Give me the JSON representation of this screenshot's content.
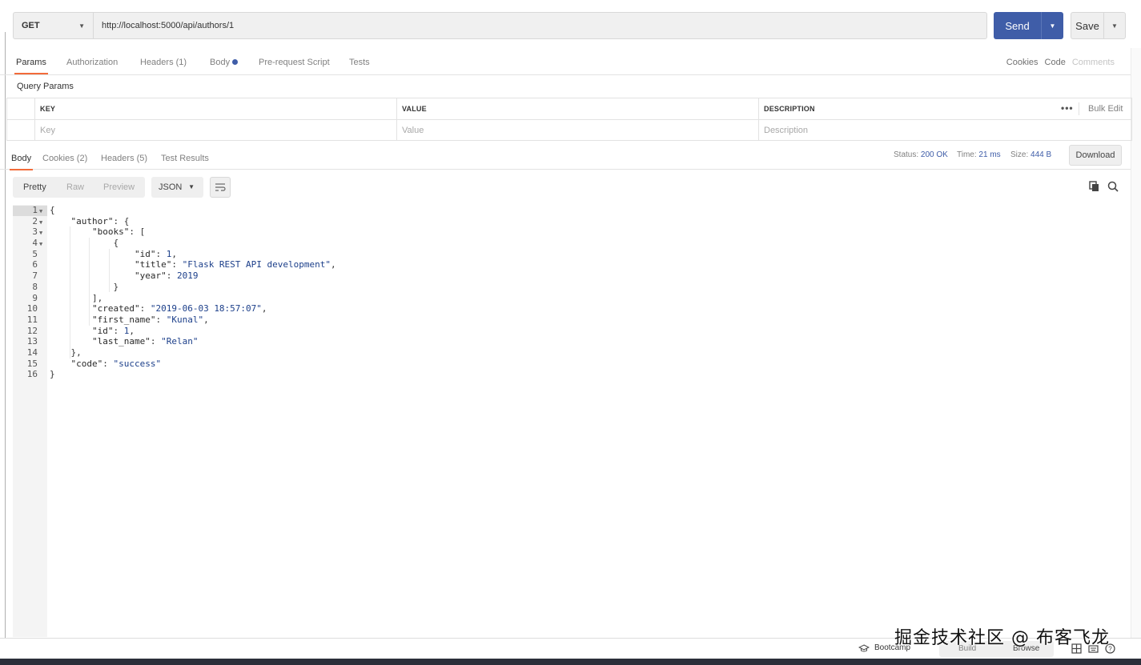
{
  "request": {
    "method": "GET",
    "url": "http://localhost:5000/api/authors/1",
    "send_label": "Send",
    "save_label": "Save"
  },
  "request_tabs": [
    {
      "label": "Params",
      "active": true
    },
    {
      "label": "Authorization"
    },
    {
      "label": "Headers (1)"
    },
    {
      "label": "Body"
    },
    {
      "label": "Pre-request Script"
    },
    {
      "label": "Tests"
    }
  ],
  "right_links": {
    "cookies": "Cookies",
    "code": "Code",
    "comments": "Comments"
  },
  "query_params": {
    "title": "Query Params",
    "headers": [
      "KEY",
      "VALUE",
      "DESCRIPTION"
    ],
    "placeholders": [
      "Key",
      "Value",
      "Description"
    ],
    "bulk_edit": "Bulk Edit"
  },
  "response_tabs": [
    {
      "label": "Body",
      "active": true
    },
    {
      "label": "Cookies (2)"
    },
    {
      "label": "Headers (5)"
    },
    {
      "label": "Test Results"
    }
  ],
  "response_meta": {
    "status_label": "Status:",
    "status_value": "200 OK",
    "time_label": "Time:",
    "time_value": "21 ms",
    "size_label": "Size:",
    "size_value": "444 B",
    "download_label": "Download"
  },
  "view_options": [
    "Pretty",
    "Raw",
    "Preview"
  ],
  "format": "JSON",
  "code_lines": [
    "{",
    "    \"author\": {",
    "        \"books\": [",
    "            {",
    "                \"id\": 1,",
    "                \"title\": \"Flask REST API development\",",
    "                \"year\": 2019",
    "            }",
    "        ],",
    "        \"created\": \"2019-06-03 18:57:07\",",
    "        \"first_name\": \"Kunal\",",
    "        \"id\": 1,",
    "        \"last_name\": \"Relan\"",
    "    },",
    "    \"code\": \"success\"",
    "}"
  ],
  "foldable_lines": [
    1,
    2,
    3,
    4
  ],
  "status_bar": {
    "bootcamp": "Bootcamp",
    "build": "Build",
    "browse": "Browse"
  },
  "watermark": "掘金技术社区 @ 布客飞龙",
  "colors": {
    "accent": "#3f5da8",
    "tab_underline": "#f26b3a"
  }
}
